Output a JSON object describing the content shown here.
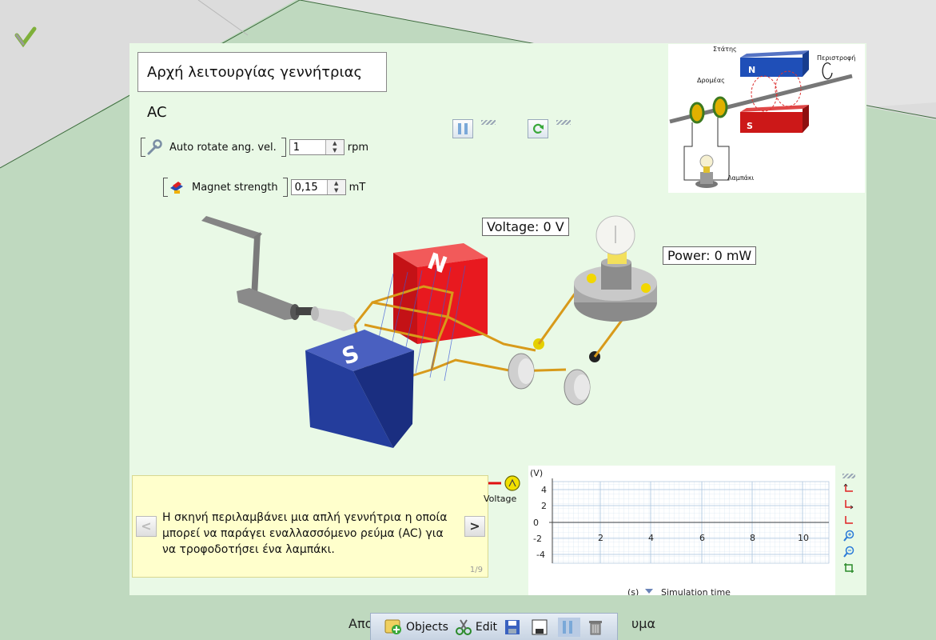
{
  "title": "Αρχή λειτουργίας γεννήτριας AC",
  "controls": {
    "rotate_label": "Auto rotate ang. vel.",
    "rotate_value": "1",
    "rotate_unit": "rpm",
    "magnet_label": "Magnet strength",
    "magnet_value": "0,15",
    "magnet_unit": "mT"
  },
  "inset_diagram": {
    "stator": "Στάτης",
    "rotors": "Δρομέας",
    "rotation": "Περιστροφή",
    "lamp": "Λαμπάκι",
    "n": "N",
    "s": "S"
  },
  "scene": {
    "magnet_north": "N",
    "magnet_south": "S",
    "voltage_label": "Voltage: 0 V",
    "power_label": "Power: 0 mW"
  },
  "info": {
    "text": "Η σκηνή περιλαμβάνει μια απλή γεννήτρια η οποία\nμπορεί να παράγει  εναλλασσόμενο ρεύμα (AC)  για\n να τροφοδοτήσει ένα λαμπάκι.",
    "page": "1/9",
    "prev": "<",
    "next": ">"
  },
  "graph": {
    "y_unit": "(V)",
    "x_unit": "(s)",
    "x_label": "Simulation time",
    "legend": "Voltage",
    "y_ticks": [
      "4",
      "2",
      "0",
      "-2",
      "-4"
    ],
    "x_ticks": [
      "2",
      "4",
      "6",
      "8",
      "10"
    ]
  },
  "bottom": {
    "left_text": "Απο",
    "right_text": "υμα",
    "objects": "Objects",
    "edit": "Edit"
  },
  "colors": {
    "panel": "#e9f9e6",
    "north": "#e8191f",
    "south": "#243d9c",
    "wire": "#d89a1a"
  }
}
